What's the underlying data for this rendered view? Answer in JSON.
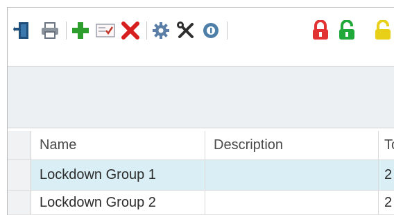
{
  "toolbar": {
    "items": [
      {
        "icon": "exit-door-icon",
        "color": "#1f4f7a"
      },
      {
        "icon": "printer-icon",
        "color": "#6b7480"
      },
      {
        "icon": "plus-icon",
        "color": "#2e9e2e"
      },
      {
        "icon": "checklist-icon",
        "color": "#c0392b"
      },
      {
        "icon": "delete-x-icon",
        "color": "#d61f1f"
      },
      {
        "icon": "gear-icon",
        "color": "#5a7ea6"
      },
      {
        "icon": "tools-icon",
        "color": "#333333"
      },
      {
        "icon": "info-disc-icon",
        "color": "#4d7fa8"
      },
      {
        "icon": "lock-red-icon",
        "color": "#e23333"
      },
      {
        "icon": "unlock-green-icon",
        "color": "#21a83a"
      },
      {
        "icon": "unlock-yellow-icon",
        "color": "#e8cf18"
      }
    ]
  },
  "grid": {
    "columns": [
      "Name",
      "Description",
      "To"
    ],
    "rows": [
      {
        "name": "Lockdown Group 1",
        "description": "",
        "total": "2",
        "selected": true
      },
      {
        "name": "Lockdown Group 2",
        "description": "",
        "total": "2",
        "selected": false
      }
    ]
  },
  "colors": {
    "selected_row": "#d9eff5",
    "band": "#edf0f2"
  }
}
